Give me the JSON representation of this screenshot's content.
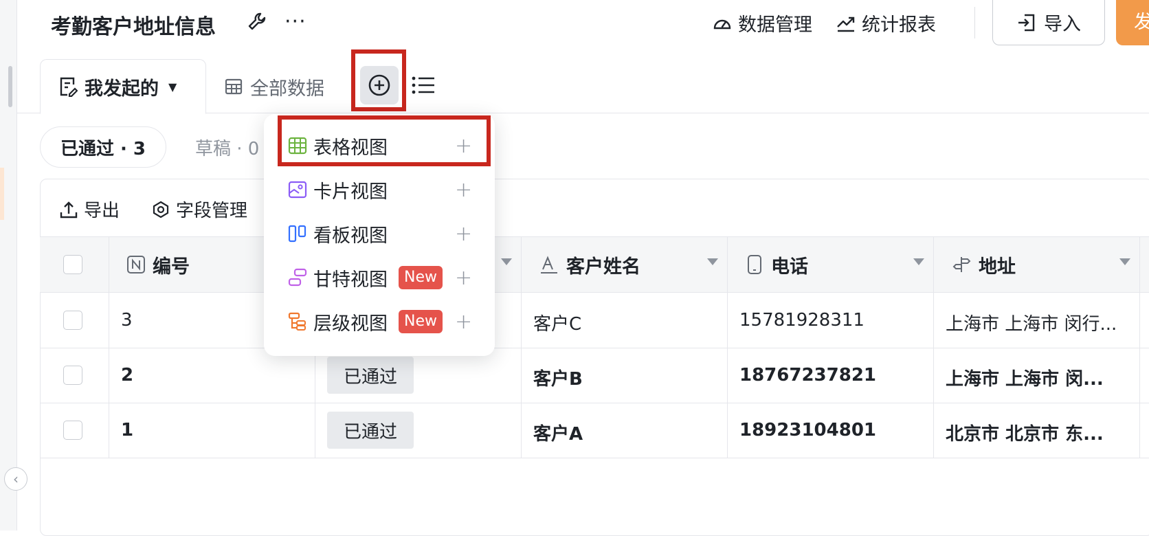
{
  "header": {
    "title": "考勤客户地址信息",
    "more": "···",
    "data_manage": "数据管理",
    "stats_report": "统计报表",
    "import": "导入",
    "submit": "发"
  },
  "tabs": {
    "mine": "我发起的",
    "all": "全部数据"
  },
  "filters": {
    "approved": "已通过 · 3",
    "draft": "草稿 · 0"
  },
  "toolbar": {
    "export": "导出",
    "fields": "字段管理"
  },
  "dropdown": {
    "items": [
      {
        "label": "表格视图",
        "badge": "",
        "plus": "+"
      },
      {
        "label": "卡片视图",
        "badge": "",
        "plus": "+"
      },
      {
        "label": "看板视图",
        "badge": "",
        "plus": "+"
      },
      {
        "label": "甘特视图",
        "badge": "New",
        "plus": "+"
      },
      {
        "label": "层级视图",
        "badge": "New",
        "plus": "+"
      }
    ]
  },
  "table": {
    "columns": [
      "编号",
      "",
      "客户姓名",
      "电话",
      "地址"
    ],
    "rows": [
      {
        "id": "3",
        "status": "",
        "name": "客户C",
        "phone": "15781928311",
        "address": "上海市 上海市 闵行..."
      },
      {
        "id": "2",
        "status": "已通过",
        "name": "客户B",
        "phone": "18767237821",
        "address": "上海市 上海市 闵..."
      },
      {
        "id": "1",
        "status": "已通过",
        "name": "客户A",
        "phone": "18923104801",
        "address": "北京市 北京市 东..."
      }
    ]
  },
  "colors": {
    "accent_orange": "#f29a4a",
    "highlight_red": "#c8271e",
    "new_badge": "#e5534b",
    "grid_icon": "#6cb33f",
    "card_icon": "#8b5cf6",
    "kanban_icon": "#3370ff",
    "gantt_icon": "#c061e8",
    "tree_icon": "#f0782e"
  }
}
